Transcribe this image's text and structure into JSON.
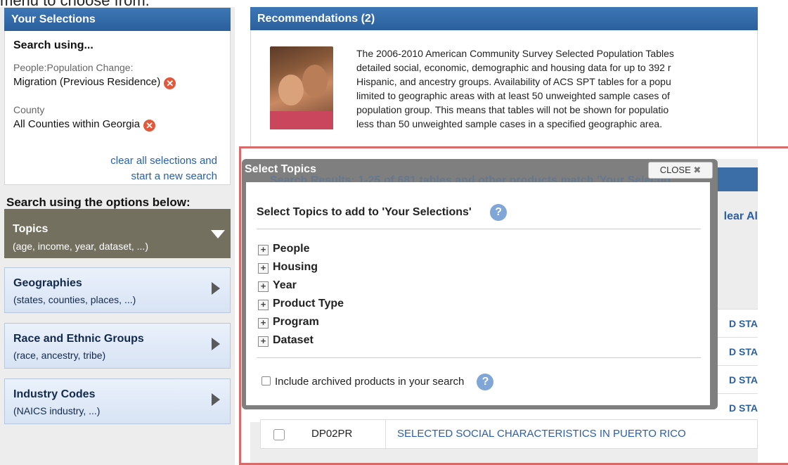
{
  "caption": "menu to choose from.",
  "your_selections": {
    "header": "Your Selections",
    "search_using": "Search using...",
    "items": [
      {
        "category": "People:Population Change:",
        "value": "Migration (Previous Residence)"
      },
      {
        "category": "County",
        "value": "All Counties within Georgia"
      }
    ],
    "clear_line1": "clear all selections and",
    "clear_line2": "start a new search"
  },
  "options": {
    "title": "Search using the options below:",
    "topics": {
      "title": "Topics",
      "sub": "(age, income, year, dataset, ...)"
    },
    "items": [
      {
        "title": "Geographies",
        "sub": "(states, counties, places, ...)"
      },
      {
        "title": "Race and Ethnic Groups",
        "sub": "(race, ancestry, tribe)"
      },
      {
        "title": "Industry Codes",
        "sub": "(NAICS industry, ...)"
      }
    ]
  },
  "recommendations": {
    "header": "Recommendations (2)",
    "lines": [
      "The 2006-2010 American Community Survey Selected Population Tables",
      "detailed social, economic, demographic and housing data for up to 392 r",
      "Hispanic, and ancestry groups. Availability of ACS SPT tables for a popu",
      "limited to geographic areas with at least 50 unweighted sample cases of",
      "population group. This means that tables will not be shown for populatio",
      "less than 50 unweighted sample cases in a specified geographic area."
    ]
  },
  "background": {
    "results_text": "Search Results: 1-25 of 681 tables and other products match 'Your Selectio",
    "clear_all": "lear Al",
    "truncated_link": "D STA",
    "last_row": {
      "id": "DP02PR",
      "title": "SELECTED SOCIAL CHARACTERISTICS IN PUERTO RICO"
    }
  },
  "modal": {
    "title": "Select Topics",
    "close_label": "CLOSE",
    "close_icon": "✖",
    "heading": "Select Topics to add to 'Your Selections'",
    "help_glyph": "?",
    "topics": [
      "People",
      "Housing",
      "Year",
      "Product Type",
      "Program",
      "Dataset"
    ],
    "plus_glyph": "+",
    "archived_label": "Include archived products in your search"
  },
  "icons": {
    "remove": "✕"
  },
  "colors": {
    "header_blue": "#2f66a5",
    "topics_bg": "#74705f",
    "remove_red": "#e2583a",
    "help_blue": "#7fa6d6",
    "frame_red": "#d86a6a"
  }
}
